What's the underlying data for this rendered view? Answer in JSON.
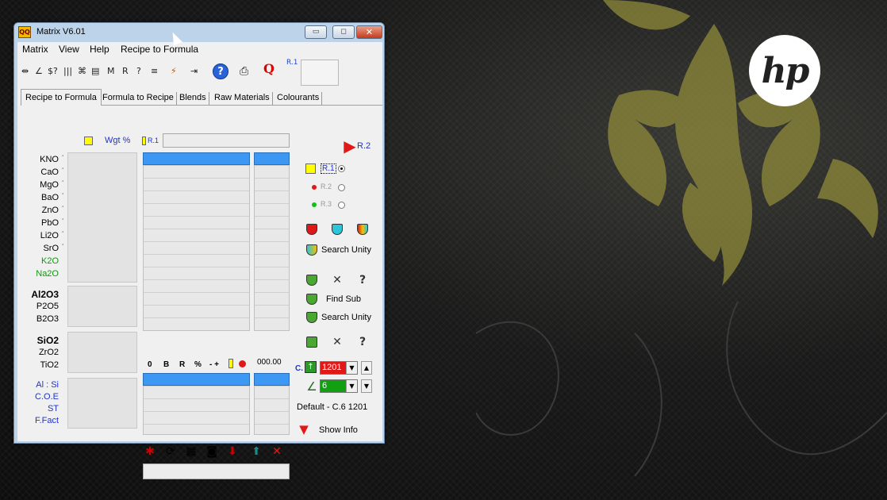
{
  "window": {
    "title": "Matrix V6.01",
    "icon_text": "QQ",
    "min_glyph": "▭",
    "max_glyph": "◻",
    "close_glyph": "✕"
  },
  "menu": [
    "Matrix",
    "View",
    "Help",
    "Recipe to Formula"
  ],
  "toolbar": {
    "glyphs": [
      "⇹",
      "∠",
      "$?",
      "|||",
      "⌘",
      "▤",
      "M",
      "R",
      "?",
      "≡",
      "⚡",
      "⇥",
      "?",
      "⎙",
      "Q"
    ],
    "r1_label": "R.1"
  },
  "tabs": [
    "Recipe to Formula",
    "Formula to Recipe",
    "Blends",
    "Raw Materials",
    "Colourants"
  ],
  "header": {
    "wgt_label": "Wgt %",
    "r1_label": "R.1"
  },
  "oxides": {
    "group1": [
      "KNO",
      "CaO",
      "MgO",
      "BaO",
      "ZnO",
      "PbO",
      "Li2O",
      "SrO",
      "K2O",
      "Na2O"
    ],
    "group2": [
      "Al2O3",
      "P2O5",
      "B2O3"
    ],
    "group3": [
      "SiO2",
      "ZrO2",
      "TiO2"
    ],
    "group4": [
      "Al : Si",
      "C.O.E",
      "ST",
      "F.Fact"
    ],
    "tick": "'"
  },
  "format_bar": {
    "buttons": [
      "0",
      "B",
      "R",
      "%",
      "- +"
    ],
    "value": "000.00"
  },
  "right_panel": {
    "r2_label": "R.2",
    "r1": "R.1",
    "r2": "R.2",
    "r3": "R.3",
    "search_unity_1": "Search Unity",
    "find_sub": "Find Sub",
    "search_unity_2": "Search Unity",
    "c_label": "C.",
    "cone_value": "1201",
    "num_value": "6",
    "default_text": "Default - C.6 1201",
    "show_info": "Show Info"
  },
  "desktop": {
    "logo_text": "hp"
  },
  "colors": {
    "selection": "#3d98f3",
    "cone_red": "#e01818",
    "cone_green": "#12a012",
    "accent_blue": "#1f34c8"
  }
}
